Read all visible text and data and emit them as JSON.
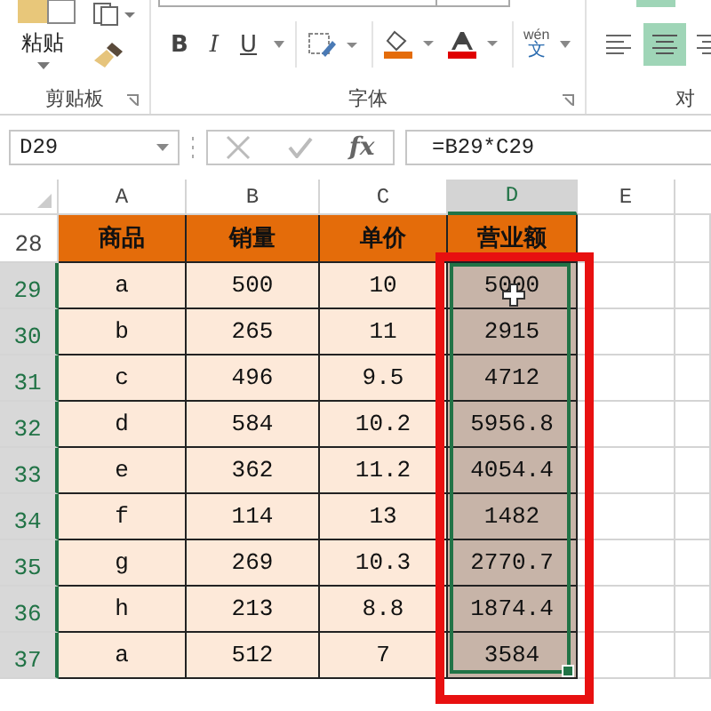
{
  "ribbon": {
    "clipboard": {
      "paste_label": "粘贴",
      "group_label": "剪贴板"
    },
    "font": {
      "group_label": "字体",
      "bold": "B",
      "italic": "I",
      "underline": "U",
      "phonetic_top": "wén",
      "phonetic_bottom": "文"
    },
    "alignment": {
      "group_label": "对"
    }
  },
  "formula_bar": {
    "name_box": "D29",
    "fx": "fx",
    "formula": "=B29*C29"
  },
  "columns": [
    {
      "label": "A",
      "selected": false
    },
    {
      "label": "B",
      "selected": false
    },
    {
      "label": "C",
      "selected": false
    },
    {
      "label": "D",
      "selected": true
    },
    {
      "label": "E",
      "selected": false
    }
  ],
  "rows": [
    {
      "number": "28",
      "selected": false,
      "kind": "header",
      "cells": [
        "商品",
        "销量",
        "单价",
        "营业额"
      ]
    },
    {
      "number": "29",
      "selected": true,
      "kind": "data",
      "cells": [
        "a",
        "500",
        "10",
        "5000"
      ]
    },
    {
      "number": "30",
      "selected": true,
      "kind": "data",
      "cells": [
        "b",
        "265",
        "11",
        "2915"
      ]
    },
    {
      "number": "31",
      "selected": true,
      "kind": "data",
      "cells": [
        "c",
        "496",
        "9.5",
        "4712"
      ]
    },
    {
      "number": "32",
      "selected": true,
      "kind": "data",
      "cells": [
        "d",
        "584",
        "10.2",
        "5956.8"
      ]
    },
    {
      "number": "33",
      "selected": true,
      "kind": "data",
      "cells": [
        "e",
        "362",
        "11.2",
        "4054.4"
      ]
    },
    {
      "number": "34",
      "selected": true,
      "kind": "data",
      "cells": [
        "f",
        "114",
        "13",
        "1482"
      ]
    },
    {
      "number": "35",
      "selected": true,
      "kind": "data",
      "cells": [
        "g",
        "269",
        "10.3",
        "2770.7"
      ]
    },
    {
      "number": "36",
      "selected": true,
      "kind": "data",
      "cells": [
        "h",
        "213",
        "8.8",
        "1874.4"
      ]
    },
    {
      "number": "37",
      "selected": true,
      "kind": "data",
      "cells": [
        "a",
        "512",
        "7",
        "3584"
      ]
    }
  ]
}
